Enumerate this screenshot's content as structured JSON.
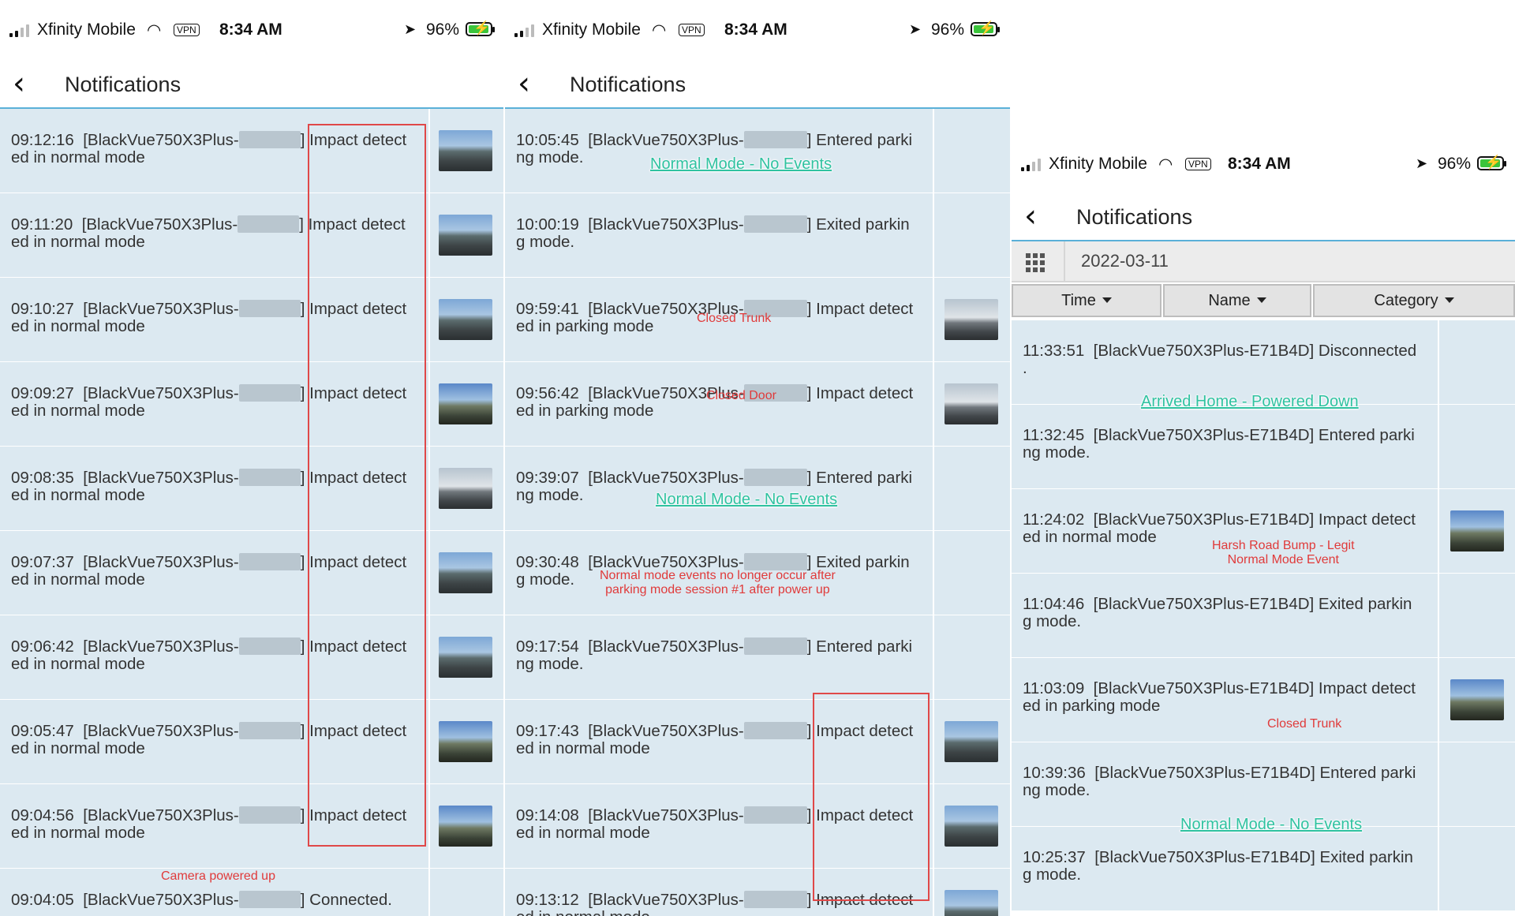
{
  "status_bar": {
    "carrier": "Xfinity Mobile",
    "vpn": "VPN",
    "time": "8:34 AM",
    "battery": "96%",
    "battery_level": 0.96,
    "wifi_icon": "wifi-icon",
    "location_icon": "location-arrow-icon"
  },
  "header": {
    "title": "Notifications",
    "back_icon": "chevron-left-icon"
  },
  "panel1": {
    "rows": [
      {
        "time": "09:12:16",
        "l1a": "[BlackVue750X3Plus-",
        "l1b": "] Impact detect",
        "l2": "ed in normal mode"
      },
      {
        "time": "09:11:20",
        "l1a": "[BlackVue750X3Plus-",
        "l1b": "] Impact detect",
        "l2": "ed in normal mode"
      },
      {
        "time": "09:10:27",
        "l1a": "[BlackVue750X3Plus-",
        "l1b": "] Impact detect",
        "l2": "ed in normal mode"
      },
      {
        "time": "09:09:27",
        "l1a": "[BlackVue750X3Plus-",
        "l1b": "] Impact detect",
        "l2": "ed in normal mode"
      },
      {
        "time": "09:08:35",
        "l1a": "[BlackVue750X3Plus-",
        "l1b": "] Impact detect",
        "l2": "ed in normal mode"
      },
      {
        "time": "09:07:37",
        "l1a": "[BlackVue750X3Plus-",
        "l1b": "] Impact detect",
        "l2": "ed in normal mode"
      },
      {
        "time": "09:06:42",
        "l1a": "[BlackVue750X3Plus-",
        "l1b": "] Impact detect",
        "l2": "ed in normal mode"
      },
      {
        "time": "09:05:47",
        "l1a": "[BlackVue750X3Plus-",
        "l1b": "] Impact detect",
        "l2": "ed in normal mode"
      },
      {
        "time": "09:04:56",
        "l1a": "[BlackVue750X3Plus-",
        "l1b": "] Impact detect",
        "l2": "ed in normal mode"
      },
      {
        "time": "09:04:05",
        "l1a": "[BlackVue750X3Plus-",
        "l1b": "] Connected.",
        "l2": ""
      }
    ],
    "annotation": "Camera powered up"
  },
  "panel2": {
    "rows": [
      {
        "time": "10:05:45",
        "l1a": "[BlackVue750X3Plus-",
        "l1b": "] Entered parki",
        "l2": "ng mode."
      },
      {
        "time": "10:00:19",
        "l1a": "[BlackVue750X3Plus-",
        "l1b": "] Exited parkin",
        "l2": "g mode."
      },
      {
        "time": "09:59:41",
        "l1a": "[BlackVue750X3Plus-",
        "l1b": "] Impact detect",
        "l2": "ed in parking mode"
      },
      {
        "time": "09:56:42",
        "l1a": "[BlackVue750X3Plus-",
        "l1b": "] Impact detect",
        "l2": "ed in parking mode"
      },
      {
        "time": "09:39:07",
        "l1a": "[BlackVue750X3Plus-",
        "l1b": "] Entered parki",
        "l2": "ng mode."
      },
      {
        "time": "09:30:48",
        "l1a": "[BlackVue750X3Plus-",
        "l1b": "] Exited parkin",
        "l2": "g mode."
      },
      {
        "time": "09:17:54",
        "l1a": "[BlackVue750X3Plus-",
        "l1b": "] Entered parki",
        "l2": "ng mode."
      },
      {
        "time": "09:17:43",
        "l1a": "[BlackVue750X3Plus-",
        "l1b": "] Impact detect",
        "l2": "ed in normal mode"
      },
      {
        "time": "09:14:08",
        "l1a": "[BlackVue750X3Plus-",
        "l1b": "] Impact detect",
        "l2": "ed in normal mode"
      },
      {
        "time": "09:13:12",
        "l1a": "[BlackVue750X3Plus-",
        "l1b": "] Impact detect",
        "l2": "ed in normal mode"
      }
    ],
    "annotations": {
      "normal_no_events_1": "Normal Mode - No Events",
      "closed_trunk": "Closed Trunk",
      "closed_door": "Closed Door",
      "normal_no_events_2": "Normal Mode - No Events",
      "no_longer_l1": "Normal mode events no longer occur after",
      "no_longer_l2": "parking mode session #1 after power up"
    }
  },
  "panel3": {
    "date": "2022-03-11",
    "filters": {
      "time": "Time",
      "name": "Name",
      "category": "Category"
    },
    "rows": [
      {
        "line1": "11:33:51  [BlackVue750X3Plus-E71B4D] Disconnected",
        "line2": "."
      },
      {
        "line1": "11:32:45  [BlackVue750X3Plus-E71B4D] Entered parki",
        "line2": "ng mode."
      },
      {
        "line1": "11:24:02  [BlackVue750X3Plus-E71B4D] Impact detect",
        "line2": "ed in normal mode"
      },
      {
        "line1": "11:04:46  [BlackVue750X3Plus-E71B4D] Exited parkin",
        "line2": "g mode."
      },
      {
        "line1": "11:03:09  [BlackVue750X3Plus-E71B4D] Impact detect",
        "line2": "ed in parking mode"
      },
      {
        "line1": "10:39:36  [BlackVue750X3Plus-E71B4D] Entered parki",
        "line2": "ng mode."
      },
      {
        "line1": "10:25:37  [BlackVue750X3Plus-E71B4D] Exited parkin",
        "line2": "g mode."
      }
    ],
    "annotations": {
      "arrived_home": "Arrived Home - Powered Down",
      "harsh_l1": "Harsh Road Bump - Legit",
      "harsh_l2": "Normal Mode Event",
      "closed_trunk": "Closed Trunk",
      "normal_no_events": "Normal Mode - No Events"
    }
  }
}
